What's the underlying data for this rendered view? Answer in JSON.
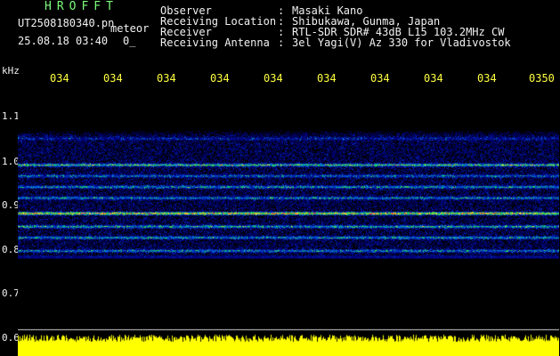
{
  "header": {
    "logo": "HROFFT",
    "filename": "UT2508180340.pn",
    "mode": "meteor",
    "datetime": "25.08.18 03:40",
    "count": "0_",
    "info": [
      {
        "label": "Observer",
        "value": "Masaki Kano"
      },
      {
        "label": "Receiving Location",
        "value": "Shibukawa, Gunma, Japan"
      },
      {
        "label": "Receiver",
        "value": "RTL-SDR SDR# 43dB L15 103.2MHz CW"
      },
      {
        "label": "Receiving Antenna",
        "value": "3el Yagi(V) Az 330 for Vladivostok"
      }
    ]
  },
  "axes": {
    "unit": "kHz",
    "time_ticks": [
      "034",
      "034",
      "034",
      "034",
      "034",
      "034",
      "034",
      "034",
      "034",
      "0350"
    ],
    "freq_ticks": [
      "1.1",
      "1.0",
      "0.9",
      "0.8",
      "0.7",
      "0.6"
    ]
  },
  "colors": {
    "background": "#000000",
    "header_green": "#7CFC7C",
    "tick_yellow": "#ffff40",
    "noise_floor": "#0a1670",
    "signal_peak": "#ff2020",
    "amplitude_bar": "#ffff00"
  },
  "spectrogram": {
    "bands_khz": [
      1.05,
      0.99,
      0.965,
      0.94,
      0.915,
      0.88,
      0.85,
      0.825,
      0.795,
      0.78
    ],
    "band_strength": [
      0.25,
      0.7,
      0.45,
      0.55,
      0.5,
      1.0,
      0.6,
      0.55,
      0.5,
      0.65
    ]
  }
}
